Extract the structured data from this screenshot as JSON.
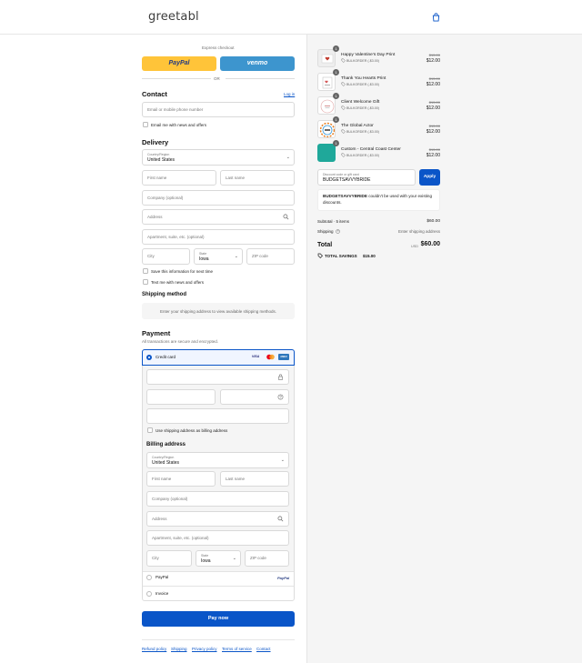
{
  "brand": {
    "name": "greetabl",
    "accent": "#0a55c8"
  },
  "express": {
    "label": "Express checkout",
    "paypal": "PayPal",
    "venmo": "venmo",
    "or": "OR"
  },
  "contact": {
    "title": "Contact",
    "login": "Log in",
    "email_placeholder": "Email or mobile phone number",
    "news_label": "Email me with news and offers"
  },
  "delivery": {
    "title": "Delivery",
    "country_label": "Country/Region",
    "country_value": "United States",
    "first_name": "First name",
    "last_name": "Last name",
    "company": "Company (optional)",
    "address": "Address",
    "apartment": "Apartment, suite, etc. (optional)",
    "city": "City",
    "state_label": "State",
    "state_value": "Iowa",
    "zip": "ZIP code",
    "save_info": "Save this information for next time",
    "text_me": "Text me with news and offers"
  },
  "shipping_method": {
    "title": "Shipping method",
    "message": "Enter your shipping address to view available shipping methods."
  },
  "payment": {
    "title": "Payment",
    "subtitle": "All transactions are secure and encrypted.",
    "credit_card": "Credit card",
    "visa": "VISA",
    "amex": "AMEX",
    "use_shipping": "Use shipping address as billing address",
    "billing_title": "Billing address",
    "paypal_option": "PayPal",
    "paypal_logo": "PayPal",
    "invoice_option": "Invoice"
  },
  "pay_button": "Pay now",
  "footer_links": [
    "Refund policy",
    "Shipping",
    "Privacy policy",
    "Terms of service",
    "Contact"
  ],
  "cart": {
    "items": [
      {
        "name": "Happy Valentine’s Day Print",
        "qty": "1",
        "discount": "BULKORDER (-$3.00)",
        "old": "$15.00",
        "price": "$12.00"
      },
      {
        "name": "Thank You Hearts Print",
        "qty": "1",
        "discount": "BULKORDER (-$3.00)",
        "old": "$15.00",
        "price": "$12.00"
      },
      {
        "name": "Client Welcome Gift",
        "qty": "1",
        "discount": "BULKORDER (-$3.00)",
        "old": "$15.00",
        "price": "$12.00"
      },
      {
        "name": "The Global Actor",
        "qty": "1",
        "discount": "BULKORDER (-$3.00)",
        "old": "$15.00",
        "price": "$12.00"
      },
      {
        "name": "Custom - Central Coast Center",
        "qty": "1",
        "discount": "BULKORDER (-$3.00)",
        "old": "$15.00",
        "price": "$12.00"
      }
    ],
    "discount_label": "Discount code or gift card",
    "discount_value": "BUDGETSAVVYBRIDE",
    "apply": "Apply",
    "error_code": "BUDGETSAVVYBRIDE",
    "error_text": " couldn't be used with your existing discounts.",
    "subtotal_label": "Subtotal · 5 items",
    "subtotal": "$60.00",
    "shipping_label": "Shipping",
    "shipping_value": "Enter shipping address",
    "total_label": "Total",
    "currency": "USD",
    "total": "$60.00",
    "savings_label": "TOTAL SAVINGS",
    "savings": "$15.00"
  }
}
